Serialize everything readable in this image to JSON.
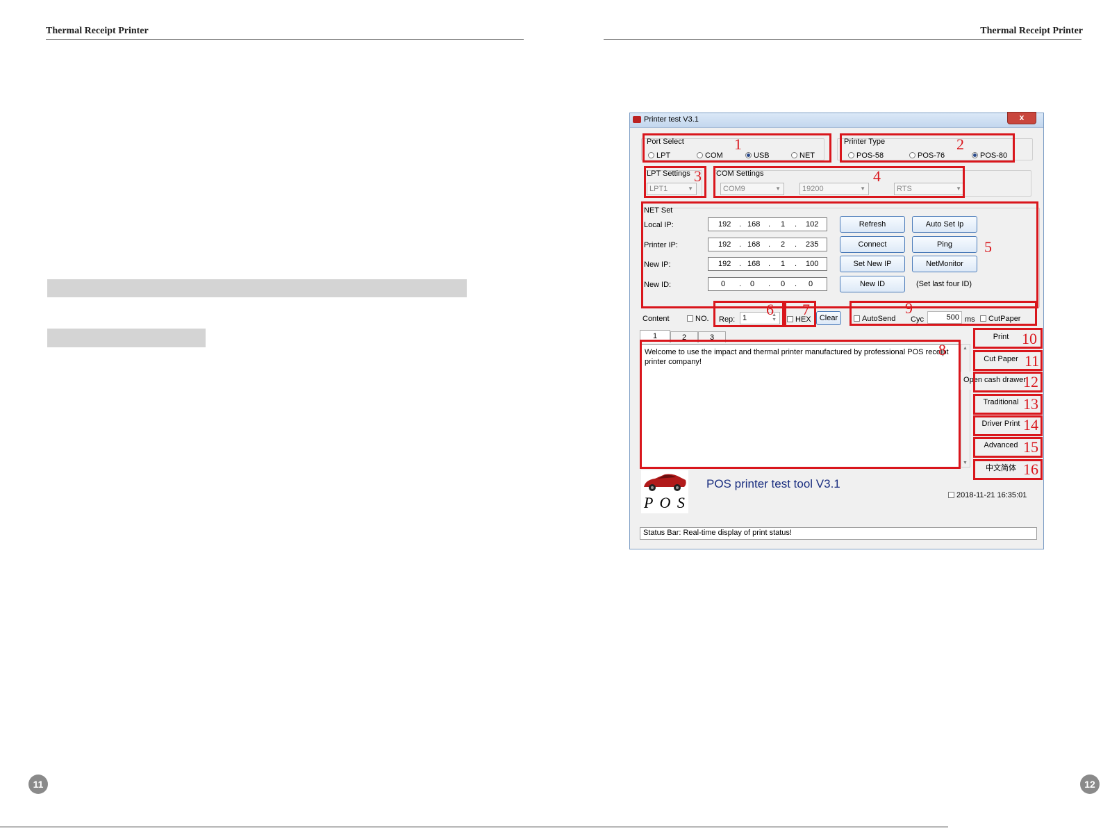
{
  "left_page": {
    "header": "Thermal Receipt Printer",
    "page_number": "11"
  },
  "right_page": {
    "header": "Thermal Receipt Printer",
    "page_number": "12"
  },
  "window": {
    "title": "Printer test V3.1",
    "close": "x",
    "port_select": {
      "label": "Port Select",
      "options": [
        "LPT",
        "COM",
        "USB",
        "NET"
      ],
      "selected": "USB"
    },
    "printer_type": {
      "label": "Printer Type",
      "options": [
        "POS-58",
        "POS-76",
        "POS-80"
      ],
      "selected": "POS-80"
    },
    "lpt_settings": {
      "label": "LPT Settings",
      "value": "LPT1"
    },
    "com_settings": {
      "label": "COM Settings",
      "port": "COM9",
      "baud": "19200",
      "flow": "RTS"
    },
    "net_set": {
      "label": "NET Set",
      "rows": [
        {
          "label": "Local IP:",
          "ip": [
            "192",
            "168",
            "1",
            "102"
          ]
        },
        {
          "label": "Printer IP:",
          "ip": [
            "192",
            "168",
            "2",
            "235"
          ]
        },
        {
          "label": "New IP:",
          "ip": [
            "192",
            "168",
            "1",
            "100"
          ]
        },
        {
          "label": "New ID:",
          "ip": [
            "0",
            "0",
            "0",
            "0"
          ]
        }
      ],
      "buttons": [
        "Refresh",
        "Auto Set Ip",
        "Connect",
        "Ping",
        "Set New IP",
        "NetMonitor",
        "New ID"
      ],
      "note": "(Set last four ID)"
    },
    "content": {
      "label": "Content",
      "no_label": "NO.",
      "rep_label": "Rep:",
      "rep_value": "1",
      "hex_label": "HEX",
      "clear": "Clear",
      "autosend": "AutoSend",
      "cyc": "Cyc",
      "cyc_value": "500",
      "ms": "ms",
      "cutpaper": "CutPaper"
    },
    "tabs": [
      "1",
      "2",
      "3"
    ],
    "text": "Welcome to use the impact and thermal printer manufactured by professional POS receipt printer company!",
    "side_buttons": [
      "Print",
      "Cut Paper",
      "Open cash drawer",
      "Traditional",
      "Driver Print",
      "Advanced",
      "中文简体"
    ],
    "logo_text": "P O S",
    "tool_title": "POS printer test tool V3.1",
    "datetime": "2018-11-21 16:35:01",
    "status_bar": "Status Bar: Real-time display of print status!"
  },
  "callouts": [
    "1",
    "2",
    "3",
    "4",
    "5",
    "6",
    "7",
    "8",
    "9",
    "10",
    "11",
    "12",
    "13",
    "14",
    "15",
    "16"
  ],
  "colors": {
    "callout": "#d9161c",
    "page_number_bg": "#8a8a8a",
    "gray_bar": "#d4d4d4"
  }
}
